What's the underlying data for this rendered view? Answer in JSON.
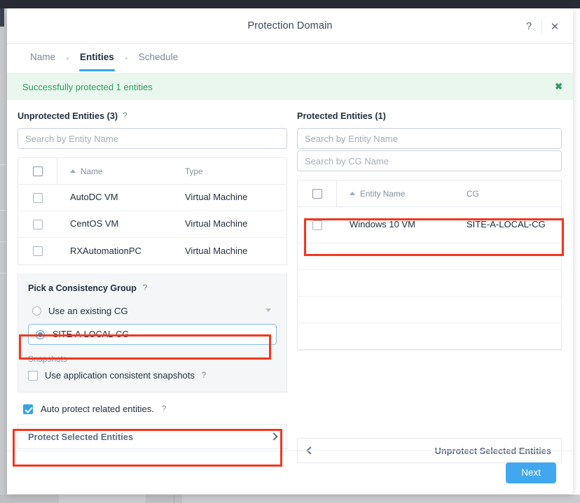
{
  "modal": {
    "title": "Protection Domain",
    "help_icon": "?",
    "close_icon": "✕"
  },
  "tabs": [
    {
      "label": "Name",
      "active": false
    },
    {
      "label": "Entities",
      "active": true
    },
    {
      "label": "Schedule",
      "active": false
    }
  ],
  "banner": {
    "text": "Successfully protected 1 entities",
    "close_icon": "✖",
    "color": "#2e9b5e",
    "background": "#e9f7ee"
  },
  "unprotected": {
    "title": "Unprotected Entities (3)",
    "help_icon": "?",
    "search_placeholder": "Search by Entity Name",
    "search_value": "",
    "columns": [
      "Name",
      "Type"
    ],
    "sort_column": "Name",
    "rows": [
      {
        "name": "AutoDC VM",
        "type": "Virtual Machine",
        "checked": false
      },
      {
        "name": "CentOS VM",
        "type": "Virtual Machine",
        "checked": false
      },
      {
        "name": "RXAutomationPC",
        "type": "Virtual Machine",
        "checked": false
      }
    ],
    "select_all_checked": false
  },
  "consistency_group": {
    "title": "Pick a Consistency Group",
    "help_icon": "?",
    "existing_option_label": "Use an existing CG",
    "existing_option_selected": false,
    "dropdown_icon": "chevron-down",
    "selected_cg": "SITE-A-LOCAL-CG",
    "selected_cg_checked": true,
    "snapshots_label": "Snapshots",
    "app_consistent_label": "Use application consistent snapshots",
    "app_consistent_checked": false,
    "app_consistent_help": "?"
  },
  "auto_protect": {
    "label": "Auto protect related entities.",
    "checked": true,
    "help_icon": "?"
  },
  "protect_action": {
    "label": "Protect Selected Entities",
    "icon": "chevron-right"
  },
  "protected": {
    "title": "Protected Entities (1)",
    "search_entity_placeholder": "Search by Entity Name",
    "search_entity_value": "",
    "search_cg_placeholder": "Search by CG Name",
    "search_cg_value": "",
    "columns": [
      "Entity Name",
      "CG"
    ],
    "sort_column": "Entity Name",
    "select_all_checked": false,
    "rows": [
      {
        "entity_name": "Windows 10 VM",
        "cg": "SITE-A-LOCAL-CG",
        "checked": false
      }
    ],
    "empty_row_count": 4
  },
  "unprotect_action": {
    "label": "Unprotect Selected Entities",
    "icon": "chevron-left"
  },
  "footer": {
    "next_label": "Next",
    "next_color": "#41a8f0"
  },
  "annotations": {
    "highlight_color": "#f5361d",
    "boxes": [
      "selected-cg-option",
      "protected-entity-row",
      "protect-selected-entities"
    ]
  }
}
